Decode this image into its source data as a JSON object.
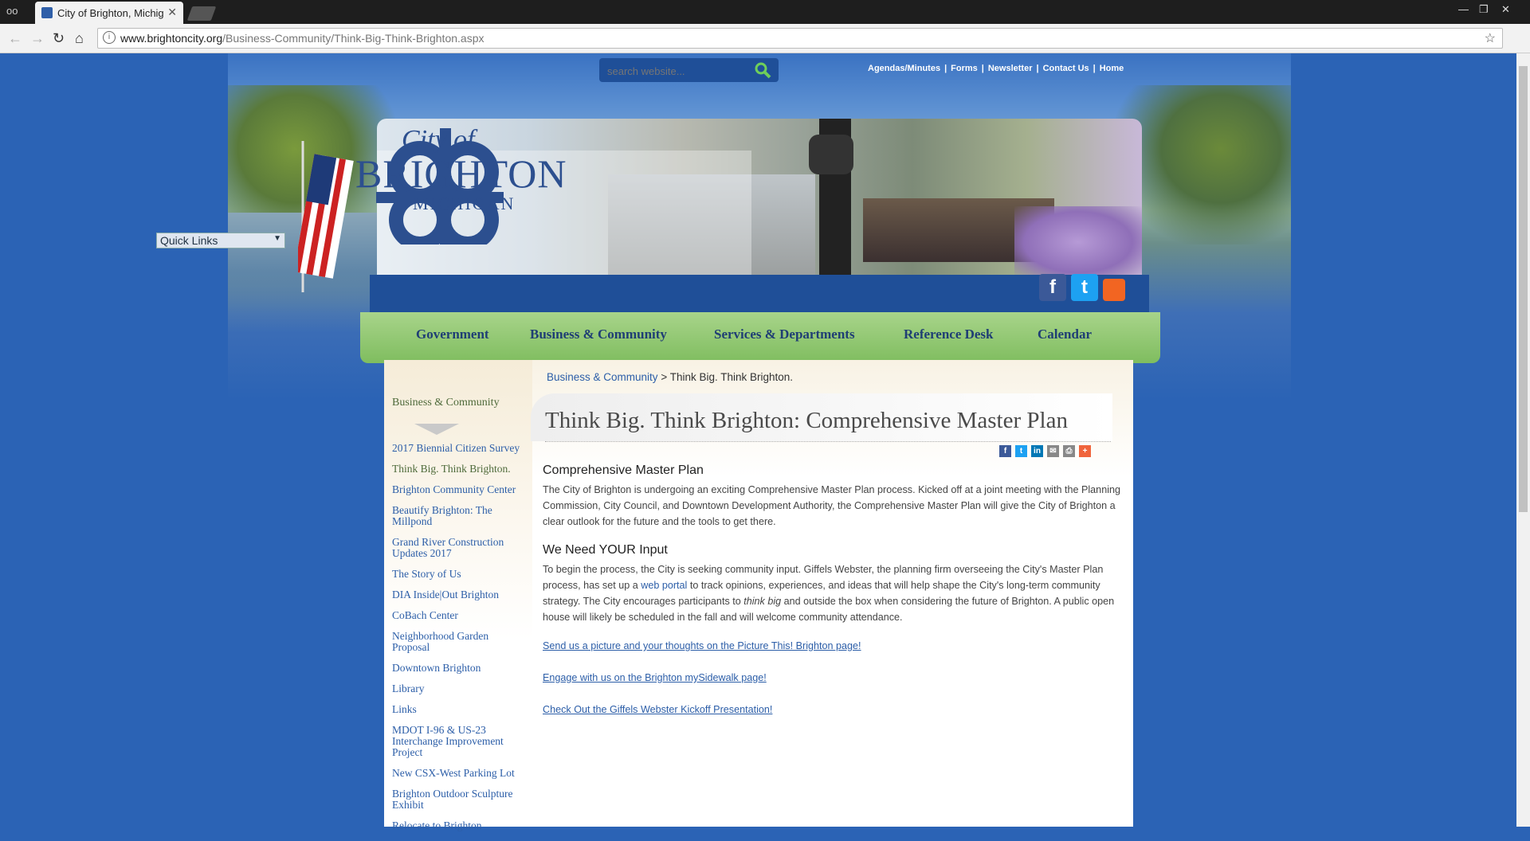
{
  "browser": {
    "tab_title": "City of Brighton, Michig",
    "url_domain": "www.brightoncity.org",
    "url_path": "/Business-Community/Think-Big-Think-Brighton.aspx"
  },
  "header": {
    "search_placeholder": "search website...",
    "top_links": [
      "Agendas/Minutes",
      "Forms",
      "Newsletter",
      "Contact Us",
      "Home"
    ],
    "logo": {
      "city_of": "City of",
      "name": "BRIGHTON",
      "state": "MICHIGAN"
    },
    "quick_links_label": "Quick Links",
    "social": [
      "f",
      "t",
      "rss"
    ]
  },
  "nav": {
    "items": [
      "Government",
      "Business & Community",
      "Services & Departments",
      "Reference Desk",
      "Calendar"
    ]
  },
  "sidebar": {
    "section": "Business & Community",
    "items": [
      "2017 Biennial Citizen Survey",
      "Think Big. Think Brighton.",
      "Brighton Community Center",
      "Beautify Brighton: The Millpond",
      "Grand River Construction Updates 2017",
      "The Story of Us",
      "DIA Inside|Out Brighton",
      "CoBach Center",
      "Neighborhood Garden Proposal",
      "Downtown Brighton",
      "Library",
      "Links",
      "MDOT I-96 & US-23 Interchange Improvement Project",
      "New CSX-West Parking Lot",
      "Brighton Outdoor Sculpture Exhibit",
      "Relocate to Brighton"
    ]
  },
  "breadcrumb": {
    "parent": "Business & Community",
    "separator": ">",
    "current": "Think Big. Think Brighton."
  },
  "content": {
    "title": "Think Big. Think Brighton: Comprehensive Master Plan",
    "h1": "Comprehensive Master Plan",
    "p1": "The City of Brighton is undergoing an exciting Comprehensive Master Plan process.  Kicked off at a joint meeting with the Planning Commission, City Council, and Downtown Development Authority, the Comprehensive Master Plan will give the City of Brighton a clear outlook for the future and the tools to get there.",
    "h2": "We Need YOUR Input",
    "p2_a": "To begin the process, the City is seeking community input.  Giffels Webster, the planning firm overseeing the City's Master Plan process, has set up a ",
    "p2_link": "web portal",
    "p2_b": " to track opinions, experiences, and ideas that will help shape the City's long-term community strategy.  The City encourages participants to ",
    "p2_em": "think big",
    "p2_c": " and outside the box when considering the future of Brighton.  A public open house will likely be scheduled in the fall and will welcome community attendance.",
    "link1": "Send us a picture and your thoughts on the Picture This! Brighton page!",
    "link2": "Engage with us on the Brighton mySidewalk page!",
    "link3": "Check Out the Giffels Webster Kickoff Presentation!"
  },
  "colors": {
    "page_bg": "#2b63b5",
    "nav_green": "#8cc56b",
    "link_blue": "#2c5ea8"
  }
}
